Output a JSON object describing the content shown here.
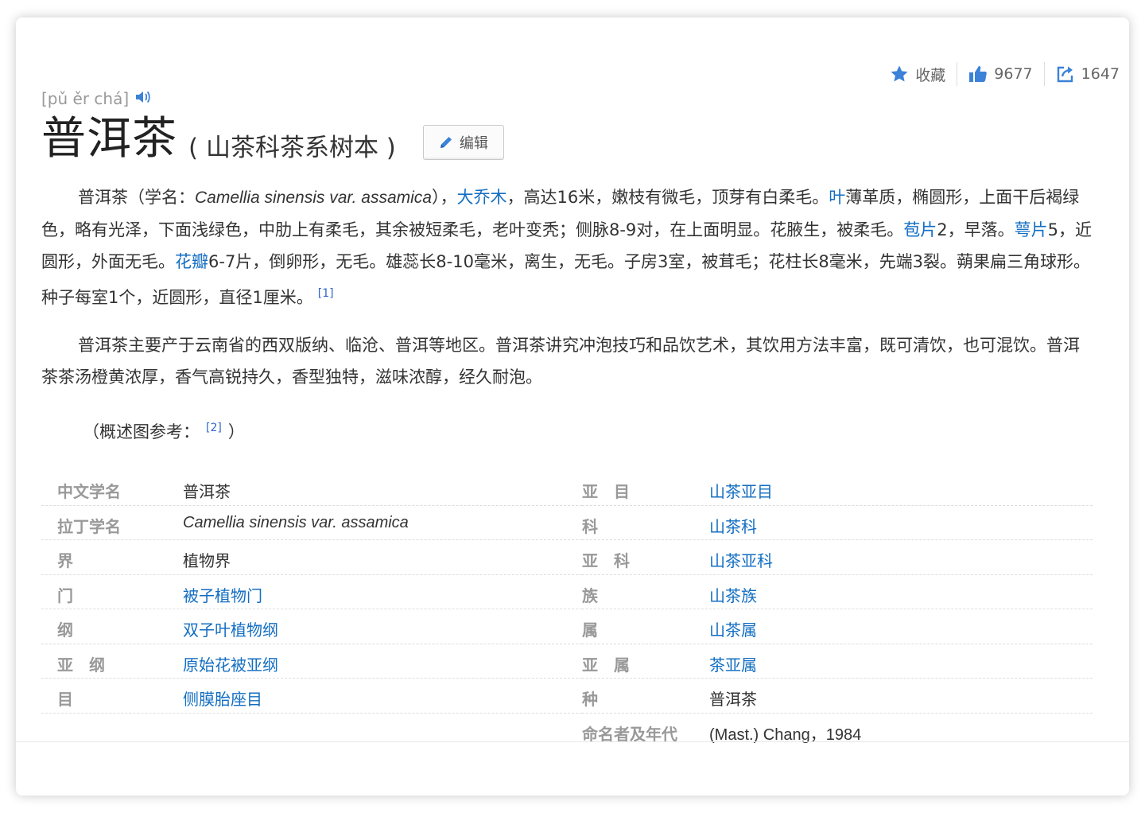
{
  "tools": {
    "favorite_label": "收藏",
    "like_count": "9677",
    "share_count": "1647"
  },
  "pinyin": "[pǔ ěr chá]",
  "title": "普洱茶",
  "subtitle": "( 山茶科茶系树本 )",
  "edit_label": "编辑",
  "p1": {
    "a": "普洱茶（学名：",
    "latin": "Camellia sinensis var. assamica",
    "b": "），",
    "link1": "大乔木",
    "c": "，高达16米，嫩枝有微毛，顶芽有白柔毛。",
    "link2": "叶",
    "d": "薄革质，椭圆形，上面干后褐绿色，略有光泽，下面浅绿色，中肋上有柔毛，其余被短柔毛，老叶变秃；侧脉8-9对，在上面明显。花腋生，被柔毛。",
    "link3": "苞片",
    "e": "2，早落。",
    "link4": "萼片",
    "f": "5，近圆形，外面无毛。",
    "link5": "花瓣",
    "g": "6-7片，倒卵形，无毛。雄蕊长8-10毫米，离生，无毛。子房3室，被茸毛；花柱长8毫米，先端3裂。蒴果扁三角球形。种子每室1个，近圆形，直径1厘米。",
    "ref": "[1]"
  },
  "p2": "普洱茶主要产于云南省的西双版纳、临沧、普洱等地区。普洱茶讲究冲泡技巧和品饮艺术，其饮用方法丰富，既可清饮，也可混饮。普洱茶茶汤橙黄浓厚，香气高锐持久，香型独特，滋味浓醇，经久耐泡。",
  "ref_note": {
    "a": "（概述图参考：",
    "ref": "[2]",
    "b": "）"
  },
  "info": {
    "left": [
      {
        "k": "中文学名",
        "v": "普洱茶"
      },
      {
        "k": "拉丁学名",
        "v": "Camellia sinensis var. assamica"
      },
      {
        "k": "界",
        "v": "植物界"
      },
      {
        "k": "门",
        "v": "被子植物门"
      },
      {
        "k": "纲",
        "v": "双子叶植物纲"
      },
      {
        "k": "亚　纲",
        "v": "原始花被亚纲"
      },
      {
        "k": "目",
        "v": "侧膜胎座目"
      }
    ],
    "right": [
      {
        "k": "亚　目",
        "v": "山茶亚目"
      },
      {
        "k": "科",
        "v": "山茶科"
      },
      {
        "k": "亚　科",
        "v": "山茶亚科"
      },
      {
        "k": "族",
        "v": "山茶族"
      },
      {
        "k": "属",
        "v": "山茶属"
      },
      {
        "k": "亚　属",
        "v": "茶亚属"
      },
      {
        "k": "种",
        "v": "普洱茶"
      },
      {
        "k": "命名者及年代",
        "v": "(Mast.) Chang，1984"
      }
    ]
  },
  "colors": {
    "link": "#136ec2",
    "accent_icon": "#3b82d8",
    "label": "#999999"
  },
  "icons": {
    "favorite": "star-icon",
    "like": "thumbs-up-icon",
    "share": "share-icon",
    "pronounce": "speaker-icon",
    "edit": "pencil-icon"
  }
}
